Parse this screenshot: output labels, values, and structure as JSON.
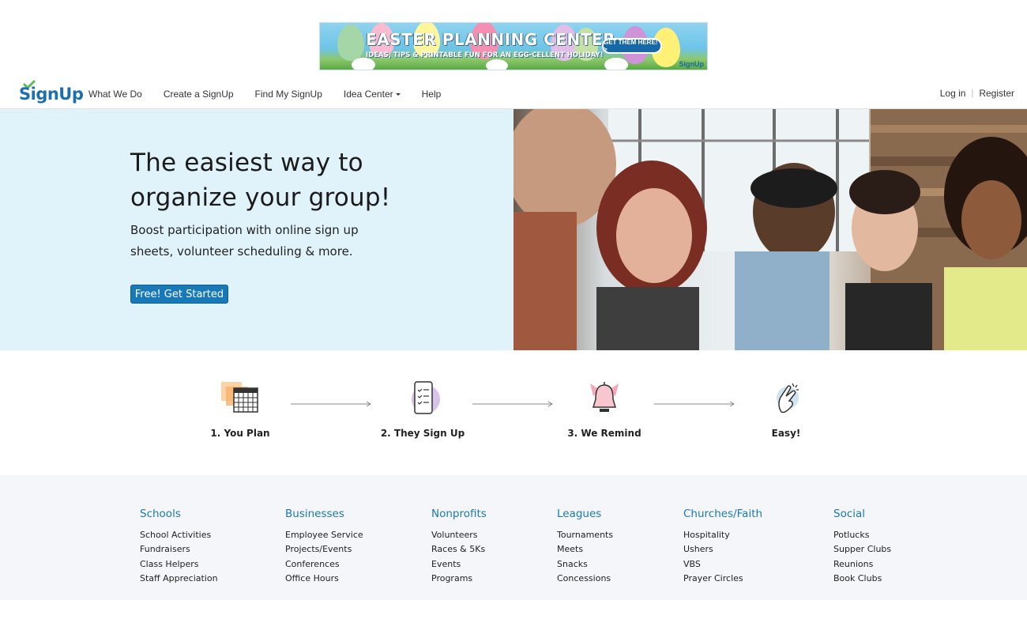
{
  "ad": {
    "title": "EASTER PLANNING CENTER",
    "subtitle": "IDEAS, TIPS & PRINTABLE FUN FOR AN EGG-CELLENT HOLIDAY!",
    "cta": "GET THEM HERE! >",
    "brand": "SignUp"
  },
  "nav": {
    "logo": "SignUp",
    "links": [
      "What We Do",
      "Create a SignUp",
      "Find My SignUp",
      "Idea Center",
      "Help"
    ],
    "login": "Log in",
    "sep": "|",
    "register": "Register"
  },
  "hero": {
    "title": "The easiest way to organize your group!",
    "subtitle": "Boost participation with online sign up sheets, volunteer scheduling & more.",
    "button": "Free! Get Started"
  },
  "steps": [
    {
      "label": "1. You Plan",
      "icon": "calendar-icon"
    },
    {
      "label": "2. They Sign Up",
      "icon": "phone-checklist-icon"
    },
    {
      "label": "3. We Remind",
      "icon": "bell-icon"
    },
    {
      "label": "Easy!",
      "icon": "snap-fingers-icon"
    }
  ],
  "categories": [
    {
      "title": "Schools",
      "items": [
        "School Activities",
        "Fundraisers",
        "Class Helpers",
        "Staff Appreciation"
      ]
    },
    {
      "title": "Businesses",
      "items": [
        "Employee Service",
        "Projects/Events",
        "Conferences",
        "Office Hours"
      ]
    },
    {
      "title": "Nonprofits",
      "items": [
        "Volunteers",
        "Races & 5Ks",
        "Events",
        "Programs"
      ]
    },
    {
      "title": "Leagues",
      "items": [
        "Tournaments",
        "Meets",
        "Snacks",
        "Concessions"
      ]
    },
    {
      "title": "Churches/Faith",
      "items": [
        "Hospitality",
        "Ushers",
        "VBS",
        "Prayer Circles"
      ]
    },
    {
      "title": "Social",
      "items": [
        "Potlucks",
        "Supper Clubs",
        "Reunions",
        "Book Clubs"
      ]
    }
  ],
  "colors": {
    "brand_blue": "#1d6fb0",
    "button_blue": "#1779b8",
    "hero_bg": "#e0f3fb",
    "category_title": "#1d7ab0",
    "footer_bg": "#f4f6f9"
  }
}
